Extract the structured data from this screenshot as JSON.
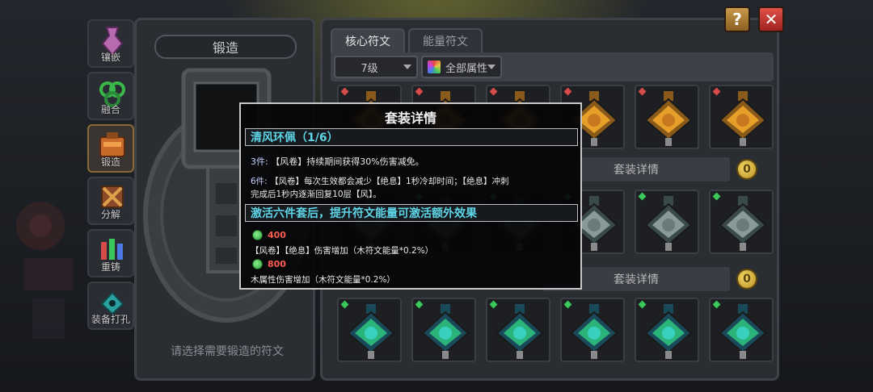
{
  "nav": [
    {
      "label": "镶嵌",
      "icon": "inlay-icon"
    },
    {
      "label": "融合",
      "icon": "fuse-icon"
    },
    {
      "label": "锻造",
      "icon": "forge-icon"
    },
    {
      "label": "分解",
      "icon": "decompose-icon"
    },
    {
      "label": "重铸",
      "icon": "recast-icon"
    },
    {
      "label": "装备打孔",
      "icon": "punch-icon"
    }
  ],
  "forge": {
    "title": "锻造",
    "hint": "请选择需要锻造的符文"
  },
  "tabs": [
    "核心符文",
    "能量符文"
  ],
  "filters": {
    "level": "7级",
    "attribute": "全部属性"
  },
  "set_bar_label": "套装详情",
  "set_bar_label_2": "套装详情",
  "coin_label": "0",
  "buttons": {
    "help": "?",
    "close": "✕"
  },
  "tooltip": {
    "title": "套装详情",
    "set_name": "清风环佩（1/6）",
    "effect3_pieces": "3件:",
    "effect3_text": "【风卷】持续期间获得30%伤害减免。",
    "effect6_pieces": "6件:",
    "effect6_line1": "【风卷】每次生效都会减少【绝息】1秒冷却时间；【绝息】冲刺",
    "effect6_line2": "完成后1秒内逐渐回复10层【风】。",
    "activate_header": "激活六件套后，提升符文能量可激活额外效果",
    "bonus1_value": "400",
    "bonus1_text": "【风卷】【绝息】伤害增加（木符文能量*0.2%）",
    "bonus2_value": "800",
    "bonus2_text": "木属性伤害增加（木符文能量*0.2%）"
  },
  "colors": {
    "accent_cyan": "#5fd4e6",
    "value_red": "#ff5a50",
    "gem_green": "#3ac85a",
    "gem_red": "#d64a4a"
  }
}
